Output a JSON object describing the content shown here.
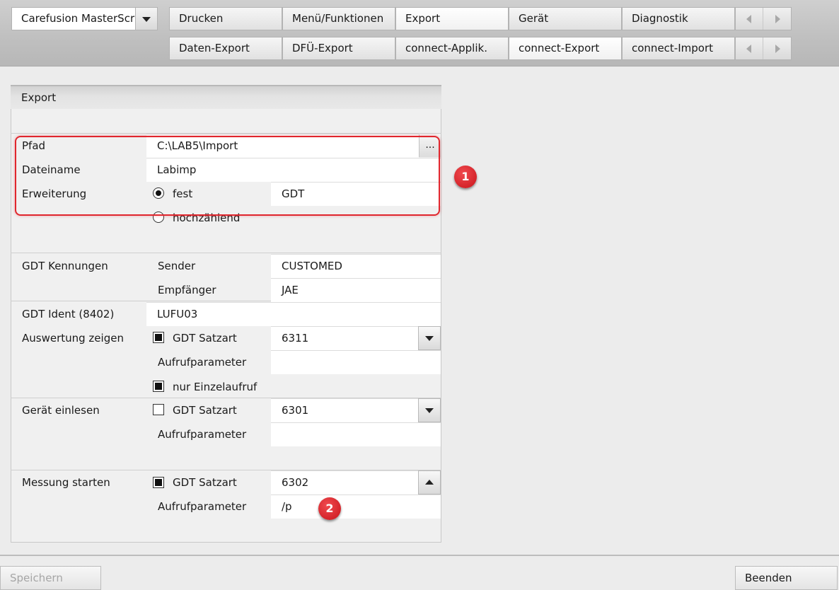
{
  "toolbar": {
    "device_select": "Carefusion MasterScr",
    "tabs_row1": [
      "Drucken",
      "Menü/Funktionen",
      "Export",
      "Gerät",
      "Diagnostik"
    ],
    "tabs_row2": [
      "Daten-Export",
      "DFÜ-Export",
      "connect-Applik.",
      "connect-Export",
      "connect-Import"
    ]
  },
  "panel": {
    "title": "Export",
    "path_label": "Pfad",
    "path_value": "C:\\LAB5\\Import",
    "browse_label": "...",
    "filename_label": "Dateiname",
    "filename_value": "Labimp",
    "extension_label": "Erweiterung",
    "ext_fixed_label": "fest",
    "ext_fixed_value": "GDT",
    "ext_counting_label": "hochzählend",
    "gdt_ids_label": "GDT Kennungen",
    "sender_label": "Sender",
    "sender_value": "CUSTOMED",
    "receiver_label": "Empfänger",
    "receiver_value": "JAE",
    "gdt_ident_label": "GDT Ident (8402)",
    "gdt_ident_value": "LUFU03",
    "show_eval_label": "Auswertung zeigen",
    "show_eval_satzart_label": "GDT Satzart",
    "show_eval_satzart_value": "6311",
    "show_eval_param_label": "Aufrufparameter",
    "show_eval_param_value": "",
    "single_call_label": "nur Einzelaufruf",
    "read_device_label": "Gerät einlesen",
    "read_device_satzart_label": "GDT Satzart",
    "read_device_satzart_value": "6301",
    "read_device_param_label": "Aufrufparameter",
    "read_device_param_value": "",
    "start_meas_label": "Messung starten",
    "start_meas_satzart_label": "GDT Satzart",
    "start_meas_satzart_value": "6302",
    "start_meas_param_label": "Aufrufparameter",
    "start_meas_param_value": "/p"
  },
  "annotations": [
    "1",
    "2"
  ],
  "footer": {
    "save_label": "Speichern",
    "exit_label": "Beenden"
  },
  "colors": {
    "highlight": "#e0262d",
    "badge": "#d5191f"
  }
}
